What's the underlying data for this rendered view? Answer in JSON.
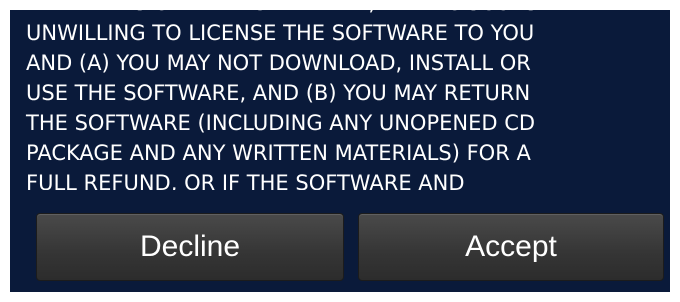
{
  "license": {
    "lines": [
      "THE TERMS OF THE AGREEMENT, THEN CISCO IS",
      "UNWILLING TO LICENSE THE SOFTWARE TO YOU",
      "AND (A) YOU MAY NOT DOWNLOAD, INSTALL OR",
      "USE THE SOFTWARE, AND (B) YOU MAY RETURN",
      "THE SOFTWARE (INCLUDING ANY UNOPENED CD",
      "PACKAGE AND ANY WRITTEN MATERIALS) FOR A",
      "FULL REFUND, OR IF THE SOFTWARE AND"
    ]
  },
  "buttons": {
    "decline_label": "Decline",
    "accept_label": "Accept"
  },
  "colors": {
    "background": "#0a1a3a",
    "text": "#ffffff",
    "button": "#3a3a3a"
  }
}
